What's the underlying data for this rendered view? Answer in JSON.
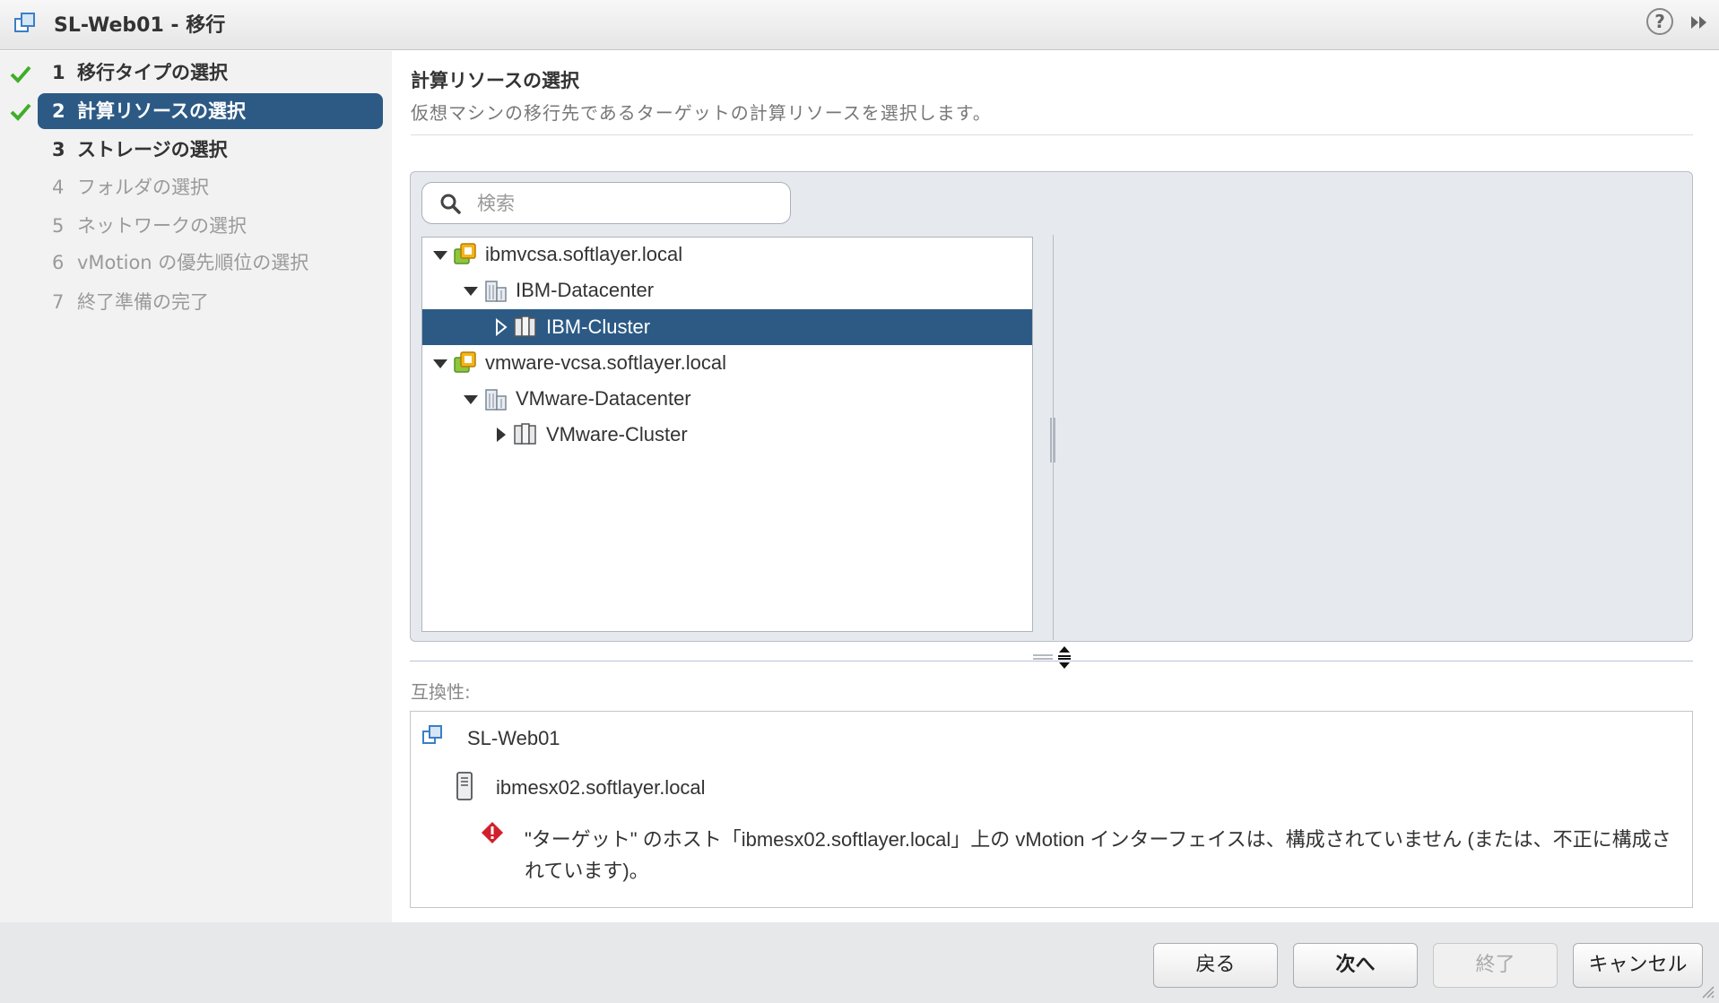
{
  "window": {
    "title": "SL-Web01 - 移行",
    "help_label": "?"
  },
  "steps": [
    {
      "num": "1",
      "label": "移行タイプの選択",
      "done": true
    },
    {
      "num": "2",
      "label": "計算リソースの選択",
      "done": true,
      "selected": true
    },
    {
      "num": "3",
      "label": "ストレージの選択"
    },
    {
      "num": "4",
      "label": "フォルダの選択",
      "disabled": true
    },
    {
      "num": "5",
      "label": "ネットワークの選択",
      "disabled": true
    },
    {
      "num": "6",
      "label": "vMotion の優先順位の選択",
      "disabled": true
    },
    {
      "num": "7",
      "label": "終了準備の完了",
      "disabled": true
    }
  ],
  "section": {
    "title": "計算リソースの選択",
    "description": "仮想マシンの移行先であるターゲットの計算リソースを選択します。"
  },
  "search": {
    "placeholder": "検索",
    "value": ""
  },
  "tree": [
    {
      "label": "ibmvcsa.softlayer.local",
      "type": "vcenter",
      "expanded": true
    },
    {
      "label": "IBM-Datacenter",
      "type": "datacenter",
      "expanded": true
    },
    {
      "label": "IBM-Cluster",
      "type": "cluster",
      "expanded": false,
      "selected": true
    },
    {
      "label": "vmware-vcsa.softlayer.local",
      "type": "vcenter",
      "expanded": true
    },
    {
      "label": "VMware-Datacenter",
      "type": "datacenter",
      "expanded": true
    },
    {
      "label": "VMware-Cluster",
      "type": "cluster",
      "expanded": false
    }
  ],
  "compat": {
    "label": "互換性:",
    "vm_name": "SL-Web01",
    "host_name": "ibmesx02.softlayer.local",
    "error_line1": "\"ターゲット\" のホスト「ibmesx02.softlayer.local」上の vMotion インターフェイスは、構成されていません (または、不正に構成さ",
    "error_line2": "れています)。"
  },
  "footer": {
    "back_label": "戻る",
    "next_label": "次へ",
    "finish_label": "終了",
    "cancel_label": "キャンセル"
  },
  "colors": {
    "accent": "#2c5a85",
    "check_green": "#3fae29",
    "error_red": "#d0202e"
  }
}
